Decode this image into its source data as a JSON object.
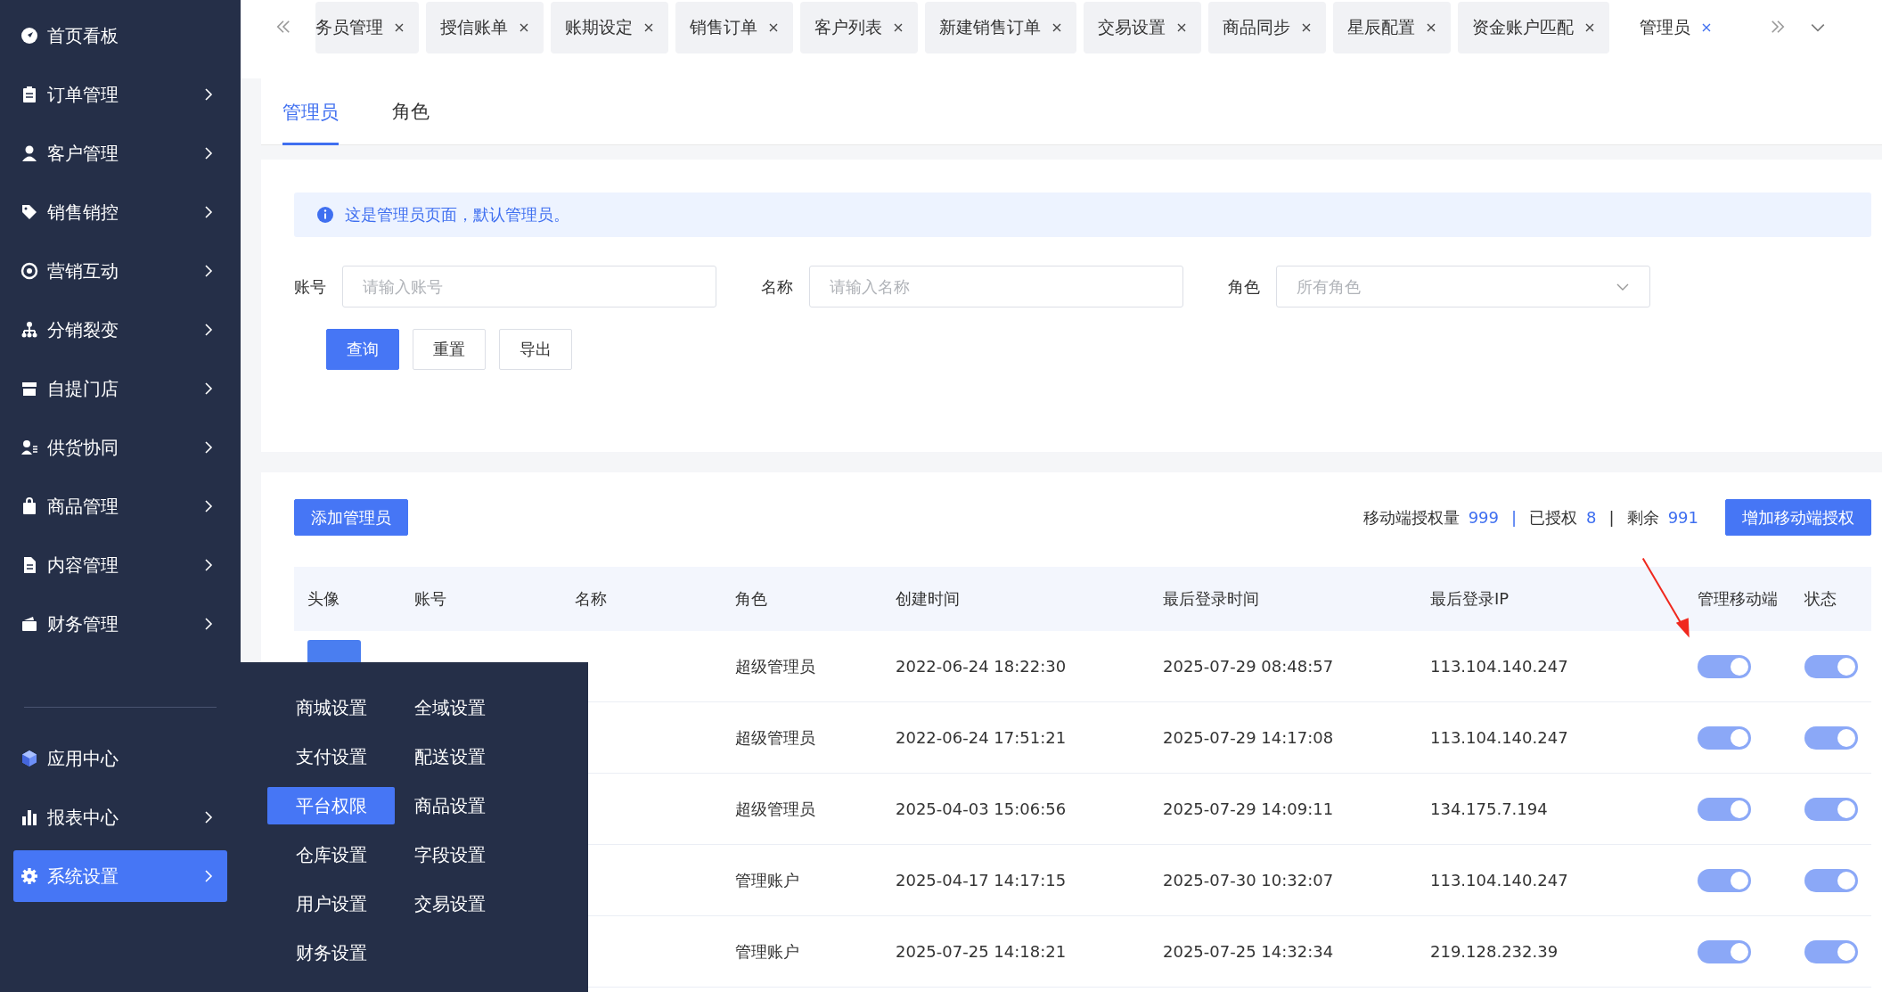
{
  "sidebar": {
    "items": [
      {
        "label": "首页看板",
        "kind": "compass",
        "expandable": false,
        "selected": false
      },
      {
        "label": "订单管理",
        "kind": "clipboard",
        "expandable": true,
        "selected": false
      },
      {
        "label": "客户管理",
        "kind": "person",
        "expandable": true,
        "selected": false
      },
      {
        "label": "销售销控",
        "kind": "tag",
        "expandable": true,
        "selected": false
      },
      {
        "label": "营销互动",
        "kind": "target",
        "expandable": true,
        "selected": false
      },
      {
        "label": "分销裂变",
        "kind": "hierarchy",
        "expandable": true,
        "selected": false
      },
      {
        "label": "自提门店",
        "kind": "store",
        "expandable": true,
        "selected": false
      },
      {
        "label": "供货协同",
        "kind": "personlist",
        "expandable": true,
        "selected": false
      },
      {
        "label": "商品管理",
        "kind": "bag",
        "expandable": true,
        "selected": false
      },
      {
        "label": "内容管理",
        "kind": "document",
        "expandable": true,
        "selected": false
      },
      {
        "label": "财务管理",
        "kind": "wallet",
        "expandable": true,
        "selected": false
      }
    ],
    "bottom_items": [
      {
        "label": "应用中心",
        "kind": "cube",
        "expandable": false,
        "selected": false
      },
      {
        "label": "报表中心",
        "kind": "barchart",
        "expandable": true,
        "selected": false
      },
      {
        "label": "系统设置",
        "kind": "gear",
        "expandable": true,
        "selected": true
      }
    ]
  },
  "tabs": [
    {
      "label": "务员管理",
      "selected": false
    },
    {
      "label": "授信账单",
      "selected": false
    },
    {
      "label": "账期设定",
      "selected": false
    },
    {
      "label": "销售订单",
      "selected": false
    },
    {
      "label": "客户列表",
      "selected": false
    },
    {
      "label": "新建销售订单",
      "selected": false
    },
    {
      "label": "交易设置",
      "selected": false
    },
    {
      "label": "商品同步",
      "selected": false
    },
    {
      "label": "星辰配置",
      "selected": false
    },
    {
      "label": "资金账户匹配",
      "selected": false
    },
    {
      "label": "管理员",
      "selected": true
    }
  ],
  "sub_tabs": [
    {
      "label": "管理员",
      "selected": true
    },
    {
      "label": "角色",
      "selected": false
    }
  ],
  "notice": "这是管理员页面，默认管理员。",
  "filters": [
    {
      "label": "账号",
      "placeholder": "请输入账号",
      "kind": "input"
    },
    {
      "label": "名称",
      "placeholder": "请输入名称",
      "kind": "input"
    },
    {
      "label": "角色",
      "placeholder": "所有角色",
      "kind": "select"
    }
  ],
  "buttons": [
    {
      "label": "查询",
      "primary": true
    },
    {
      "label": "重置",
      "primary": false
    },
    {
      "label": "导出",
      "primary": false
    }
  ],
  "add_button": "添加管理员",
  "license": [
    {
      "label": "移动端授权量",
      "value": "999"
    },
    {
      "label": "已授权",
      "value": "8"
    },
    {
      "label": "剩余",
      "value": "991"
    }
  ],
  "license_separator": "|",
  "increase_button": "增加移动端授权",
  "table": {
    "columns": [
      "头像",
      "账号",
      "名称",
      "角色",
      "创建时间",
      "最后登录时间",
      "最后登录IP",
      "管理移动端",
      "状态"
    ],
    "rows": [
      {
        "role": "超级管理员",
        "created": "2022-06-24 18:22:30",
        "last_login": "2025-07-29 08:48:57",
        "ip": "113.104.140.247",
        "mobile_on": true,
        "status_on": true
      },
      {
        "role": "超级管理员",
        "created": "2022-06-24 17:51:21",
        "last_login": "2025-07-29 14:17:08",
        "ip": "113.104.140.247",
        "mobile_on": true,
        "status_on": true
      },
      {
        "role": "超级管理员",
        "created": "2025-04-03 15:06:56",
        "last_login": "2025-07-29 14:09:11",
        "ip": "134.175.7.194",
        "mobile_on": true,
        "status_on": true
      },
      {
        "role": "管理账户",
        "created": "2025-04-17 14:17:15",
        "last_login": "2025-07-30 10:32:07",
        "ip": "113.104.140.247",
        "mobile_on": true,
        "status_on": true
      },
      {
        "role": "管理账户",
        "created": "2025-07-25 14:18:21",
        "last_login": "2025-07-25 14:32:34",
        "ip": "219.128.232.39",
        "mobile_on": true,
        "status_on": true
      }
    ]
  },
  "popup_menu": {
    "items": [
      {
        "label": "商城设置",
        "selected": false
      },
      {
        "label": "全域设置",
        "selected": false
      },
      {
        "label": "支付设置",
        "selected": false
      },
      {
        "label": "配送设置",
        "selected": false
      },
      {
        "label": "平台权限",
        "selected": true
      },
      {
        "label": "商品设置",
        "selected": false
      },
      {
        "label": "仓库设置",
        "selected": false
      },
      {
        "label": "字段设置",
        "selected": false
      },
      {
        "label": "用户设置",
        "selected": false
      },
      {
        "label": "交易设置",
        "selected": false
      },
      {
        "label": "财务设置",
        "selected": false
      }
    ]
  }
}
